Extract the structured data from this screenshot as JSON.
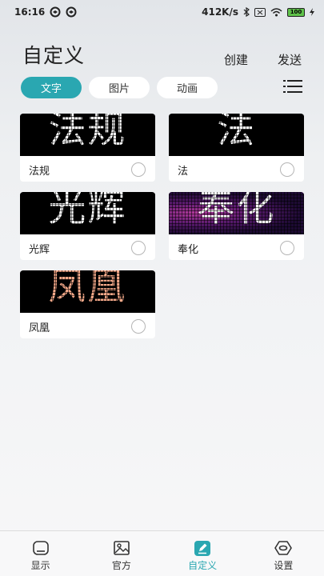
{
  "status_bar": {
    "time": "16:16",
    "network_speed": "412K/s",
    "battery": "100"
  },
  "header": {
    "title": "自定义",
    "create_label": "创建",
    "send_label": "发送"
  },
  "tabs": [
    {
      "label": "文字",
      "active": true
    },
    {
      "label": "图片",
      "active": false
    },
    {
      "label": "动画",
      "active": false
    }
  ],
  "cards": [
    {
      "label": "法规",
      "preview_text": "法规",
      "style": "white-on-black"
    },
    {
      "label": "法",
      "preview_text": "法",
      "style": "white-on-black"
    },
    {
      "label": "光辉",
      "preview_text": "光辉",
      "style": "white-on-black"
    },
    {
      "label": "奉化",
      "preview_text": "奉化",
      "style": "white-on-purple"
    },
    {
      "label": "凤凰",
      "preview_text": "凤凰",
      "style": "peach-on-black"
    }
  ],
  "bottom_nav": [
    {
      "label": "显示",
      "icon": "display-icon",
      "active": false
    },
    {
      "label": "官方",
      "icon": "image-icon",
      "active": false
    },
    {
      "label": "自定义",
      "icon": "edit-icon",
      "active": true
    },
    {
      "label": "设置",
      "icon": "settings-icon",
      "active": false
    }
  ],
  "colors": {
    "accent": "#2aa7b1",
    "preview_peach": "#f4a989"
  }
}
